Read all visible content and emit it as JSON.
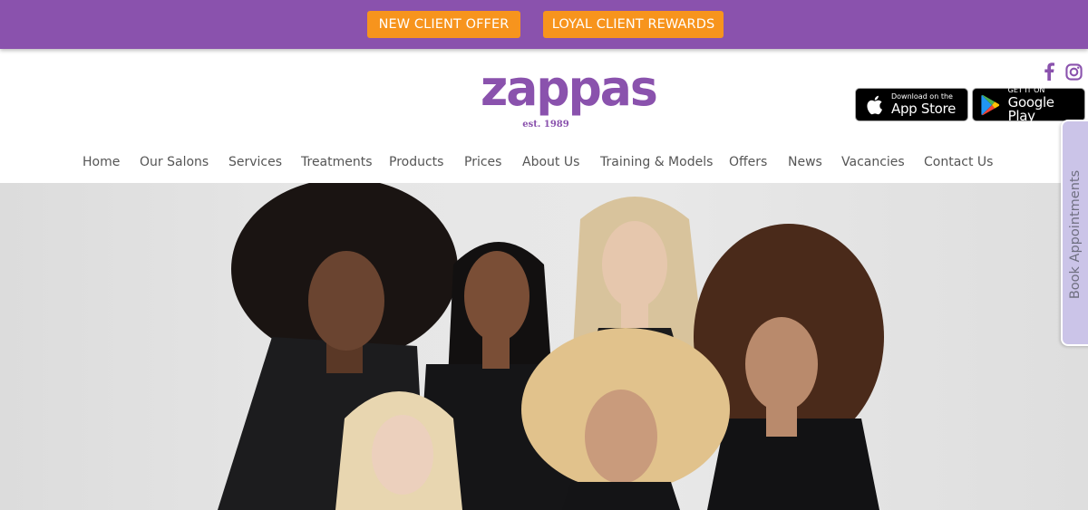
{
  "promo": {
    "new_client_offer": "NEW CLIENT OFFER",
    "loyal_client_rewards": "LOYAL CLIENT REWARDS"
  },
  "logo": {
    "wordmark": "zappas",
    "established": "est. 1989"
  },
  "social": {
    "facebook_icon": "facebook-icon",
    "instagram_icon": "instagram-icon"
  },
  "badges": {
    "apple_small": "Download on the",
    "apple_big": "App Store",
    "google_small": "GET IT ON",
    "google_big": "Google Play"
  },
  "nav": {
    "items": [
      "Home",
      "Our Salons",
      "Services",
      "Treatments",
      "Products",
      "Prices",
      "About Us",
      "Training & Models",
      "Offers",
      "News",
      "Vacancies",
      "Contact Us"
    ]
  },
  "book_tab": {
    "label": "Book Appointments"
  },
  "colors": {
    "brand_purple": "#8a52ad",
    "accent_orange": "#f7941d",
    "tab_lavender": "#cbc4e8"
  }
}
